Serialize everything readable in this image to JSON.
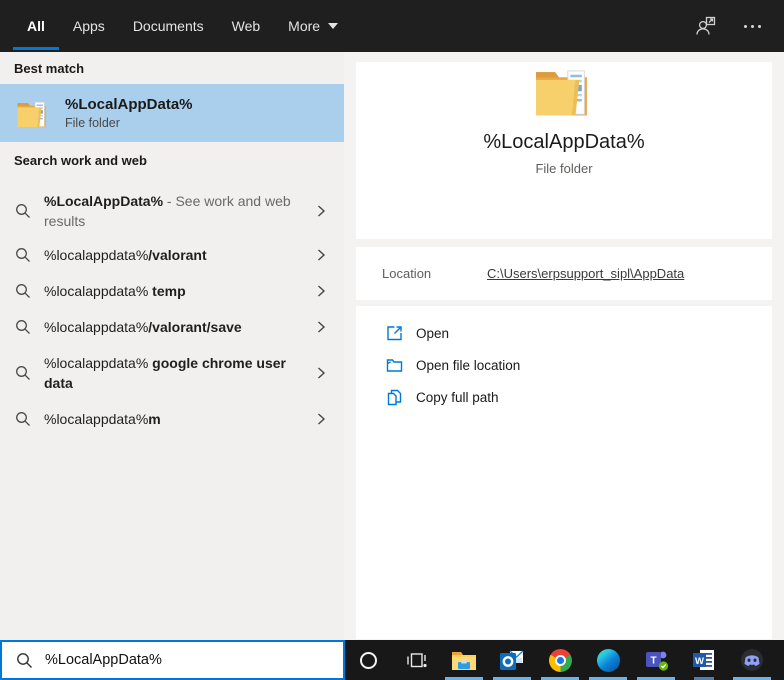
{
  "navbar": {
    "tabs": [
      {
        "label": "All",
        "active": true
      },
      {
        "label": "Apps",
        "active": false
      },
      {
        "label": "Documents",
        "active": false
      },
      {
        "label": "Web",
        "active": false
      },
      {
        "label": "More",
        "active": false,
        "has_dropdown": true
      }
    ],
    "right_icons": [
      "user-account-icon",
      "more-options-icon"
    ]
  },
  "left_panel": {
    "best_match_header": "Best match",
    "best_match": {
      "title": "%LocalAppData%",
      "subtitle": "File folder"
    },
    "search_web_header": "Search work and web",
    "suggestions": [
      {
        "query": "%LocalAppData%",
        "suffix": " - See work and web results"
      },
      {
        "query": "%localappdata%",
        "completion": "/valorant"
      },
      {
        "query": "%localappdata%",
        "completion": " temp"
      },
      {
        "query": "%localappdata%",
        "completion": "/valorant/save"
      },
      {
        "query": "%localappdata%",
        "completion": " google chrome user data"
      },
      {
        "query": "%localappdata%",
        "completion": "m"
      }
    ]
  },
  "preview": {
    "title": "%LocalAppData%",
    "subtitle": "File folder",
    "location_label": "Location",
    "location_link": "C:\\Users\\erpsupport_sipl\\AppData",
    "actions": [
      {
        "icon": "open-icon",
        "label": "Open"
      },
      {
        "icon": "open-file-location-icon",
        "label": "Open file location"
      },
      {
        "icon": "copy-full-path-icon",
        "label": "Copy full path"
      }
    ]
  },
  "search_box": {
    "value": "%LocalAppData%",
    "icon": "search-icon"
  },
  "taskbar": {
    "icons": [
      {
        "name": "cortana-icon",
        "running": false
      },
      {
        "name": "task-view-icon",
        "running": false
      },
      {
        "name": "file-explorer-icon",
        "running": true
      },
      {
        "name": "outlook-icon",
        "running": true
      },
      {
        "name": "chrome-icon",
        "running": true
      },
      {
        "name": "edge-icon",
        "running": true
      },
      {
        "name": "teams-icon",
        "running": true
      },
      {
        "name": "word-icon",
        "running": true
      },
      {
        "name": "discord-icon",
        "running": true
      }
    ]
  },
  "colors": {
    "accent_blue": "#0078d7",
    "best_match_highlight": "#a9cfec",
    "navbar_bg": "#1f1f1f",
    "taskbar_bg": "#181818",
    "taskbar_underline": "#6cb2e8",
    "left_panel_bg": "#f1f0ee",
    "right_panel_bg": "#f4f3f2"
  }
}
